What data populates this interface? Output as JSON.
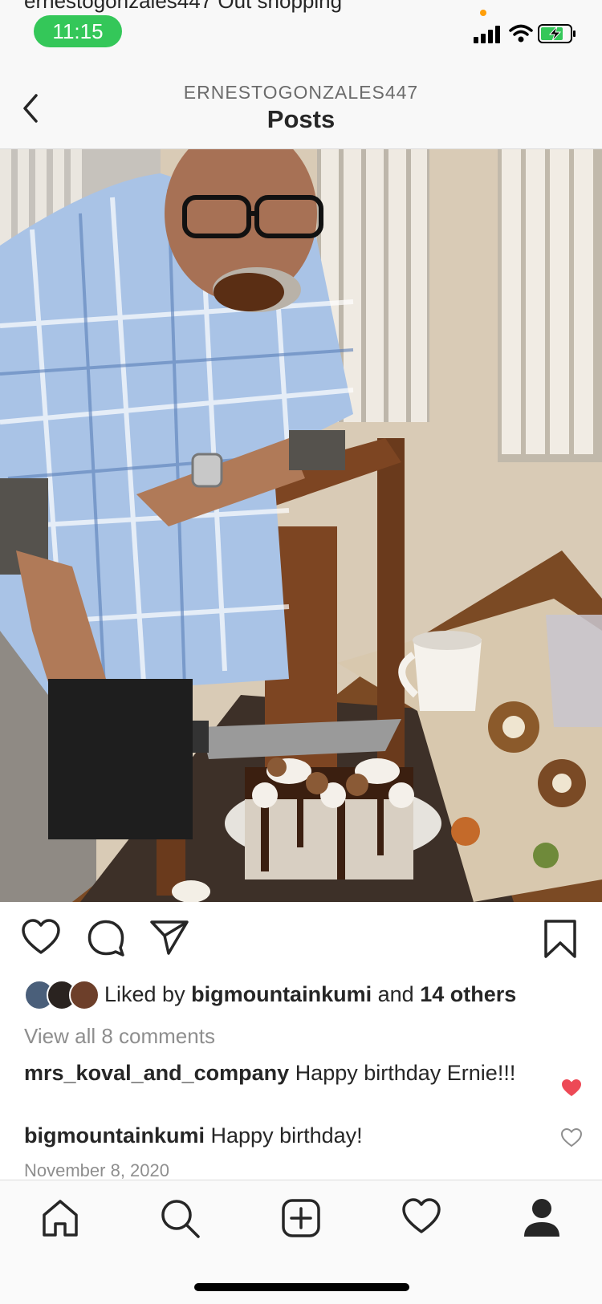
{
  "status_bar": {
    "clipped_text": "ernestogonzales447 Out shopping",
    "time": "11:15",
    "signal_icon": "cellular-signal-icon",
    "wifi_icon": "wifi-icon",
    "battery_icon": "battery-charging-icon",
    "time_pill_color": "#34c759"
  },
  "header": {
    "back_icon": "chevron-left-icon",
    "username": "ERNESTOGONZALES447",
    "title": "Posts"
  },
  "post": {
    "photo_description_icon": "post-photo",
    "actions": {
      "like_icon": "heart-outline-icon",
      "comment_icon": "comment-bubble-icon",
      "share_icon": "paper-plane-icon",
      "save_icon": "bookmark-icon"
    },
    "likes": {
      "prefix": "Liked by",
      "user": "bigmountainkumi",
      "middle": "and",
      "others": "14 others"
    },
    "view_all_comments": "View all 8 comments",
    "comments": [
      {
        "user": "mrs_koval_and_company",
        "text": "Happy birthday Ernie!!!",
        "liked": true
      },
      {
        "user": "bigmountainkumi",
        "text": "Happy birthday!",
        "liked": false
      }
    ],
    "date": "November 8, 2020"
  },
  "tabbar": {
    "items": [
      "home-icon",
      "search-icon",
      "new-post-icon",
      "activity-heart-icon",
      "profile-icon"
    ]
  },
  "colors": {
    "liked_heart": "#ed4956",
    "muted_text": "#8e8e8e"
  }
}
